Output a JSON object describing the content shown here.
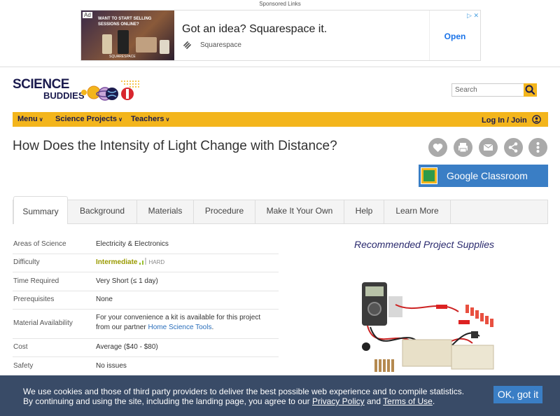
{
  "ad": {
    "sponsored_label": "Sponsored Links",
    "ad_tag": "Ad",
    "image_text": "WANT TO START SELLING SESSIONS ONLINE?",
    "image_subtext": "SQUARESPACE",
    "headline": "Got an idea? Squarespace it.",
    "brand": "Squarespace",
    "open_label": "Open",
    "close_glyphs": "▷ ✕"
  },
  "header": {
    "logo_line1": "SCIENCE",
    "logo_line2": "BUDDIES",
    "search_placeholder": "Search"
  },
  "nav": {
    "menu": "Menu",
    "projects": "Science Projects",
    "teachers": "Teachers",
    "login": "Log In / Join"
  },
  "page": {
    "title": "How Does the Intensity of Light Change with Distance?",
    "google_classroom": "Google Classroom"
  },
  "tabs": [
    "Summary",
    "Background",
    "Materials",
    "Procedure",
    "Make It Your Own",
    "Help",
    "Learn More"
  ],
  "info": {
    "areas_label": "Areas of Science",
    "areas_value": "Electricity & Electronics",
    "difficulty_label": "Difficulty",
    "difficulty_value": "Intermediate",
    "difficulty_hard": "HARD",
    "difficulty_level": 0.66,
    "time_label": "Time Required",
    "time_value": "Very Short (≤ 1 day)",
    "prereq_label": "Prerequisites",
    "prereq_value": "None",
    "material_label": "Material Availability",
    "material_text1": "For your convenience a kit is available for this project",
    "material_text2": "from our partner",
    "material_link": "Home Science Tools",
    "material_period": ".",
    "cost_label": "Cost",
    "cost_value": "Average ($40 - $80)",
    "safety_label": "Safety",
    "safety_value": "No issues"
  },
  "supplies": {
    "heading": "Recommended Project Supplies"
  },
  "cookie": {
    "line1": "We use cookies and those of third party providers to deliver the best possible web experience and to compile statistics.",
    "line2_pre": "By continuing and using the site, including the landing page, you agree to our",
    "privacy": "Privacy Policy",
    "and": "and",
    "terms": "Terms of Use",
    "end": ".",
    "ok": "OK, got it"
  },
  "colors": {
    "nav": "#f3b51c",
    "brand_navy": "#1b1b4e",
    "classroom_blue": "#3a7ec5"
  }
}
